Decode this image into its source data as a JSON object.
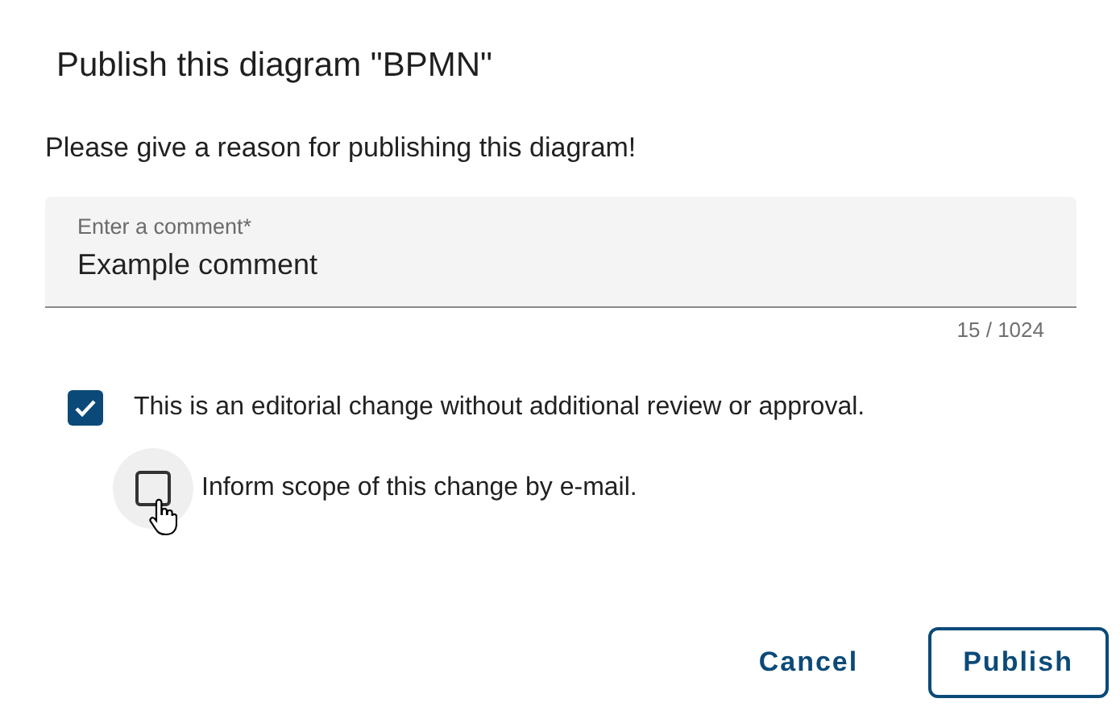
{
  "dialog": {
    "title": "Publish this diagram \"BPMN\"",
    "message": "Please give a reason for publishing this diagram!",
    "comment_field": {
      "label": "Enter a comment*",
      "value": "Example comment",
      "counter": "15 / 1024"
    },
    "options": [
      {
        "label": "This is an editorial change without additional review or approval.",
        "checked": true,
        "hovered": false
      },
      {
        "label": "Inform scope of this change by e-mail.",
        "checked": false,
        "hovered": true
      }
    ],
    "buttons": [
      {
        "label": "Cancel",
        "kind": "text"
      },
      {
        "label": "Publish",
        "kind": "outlined"
      }
    ]
  }
}
